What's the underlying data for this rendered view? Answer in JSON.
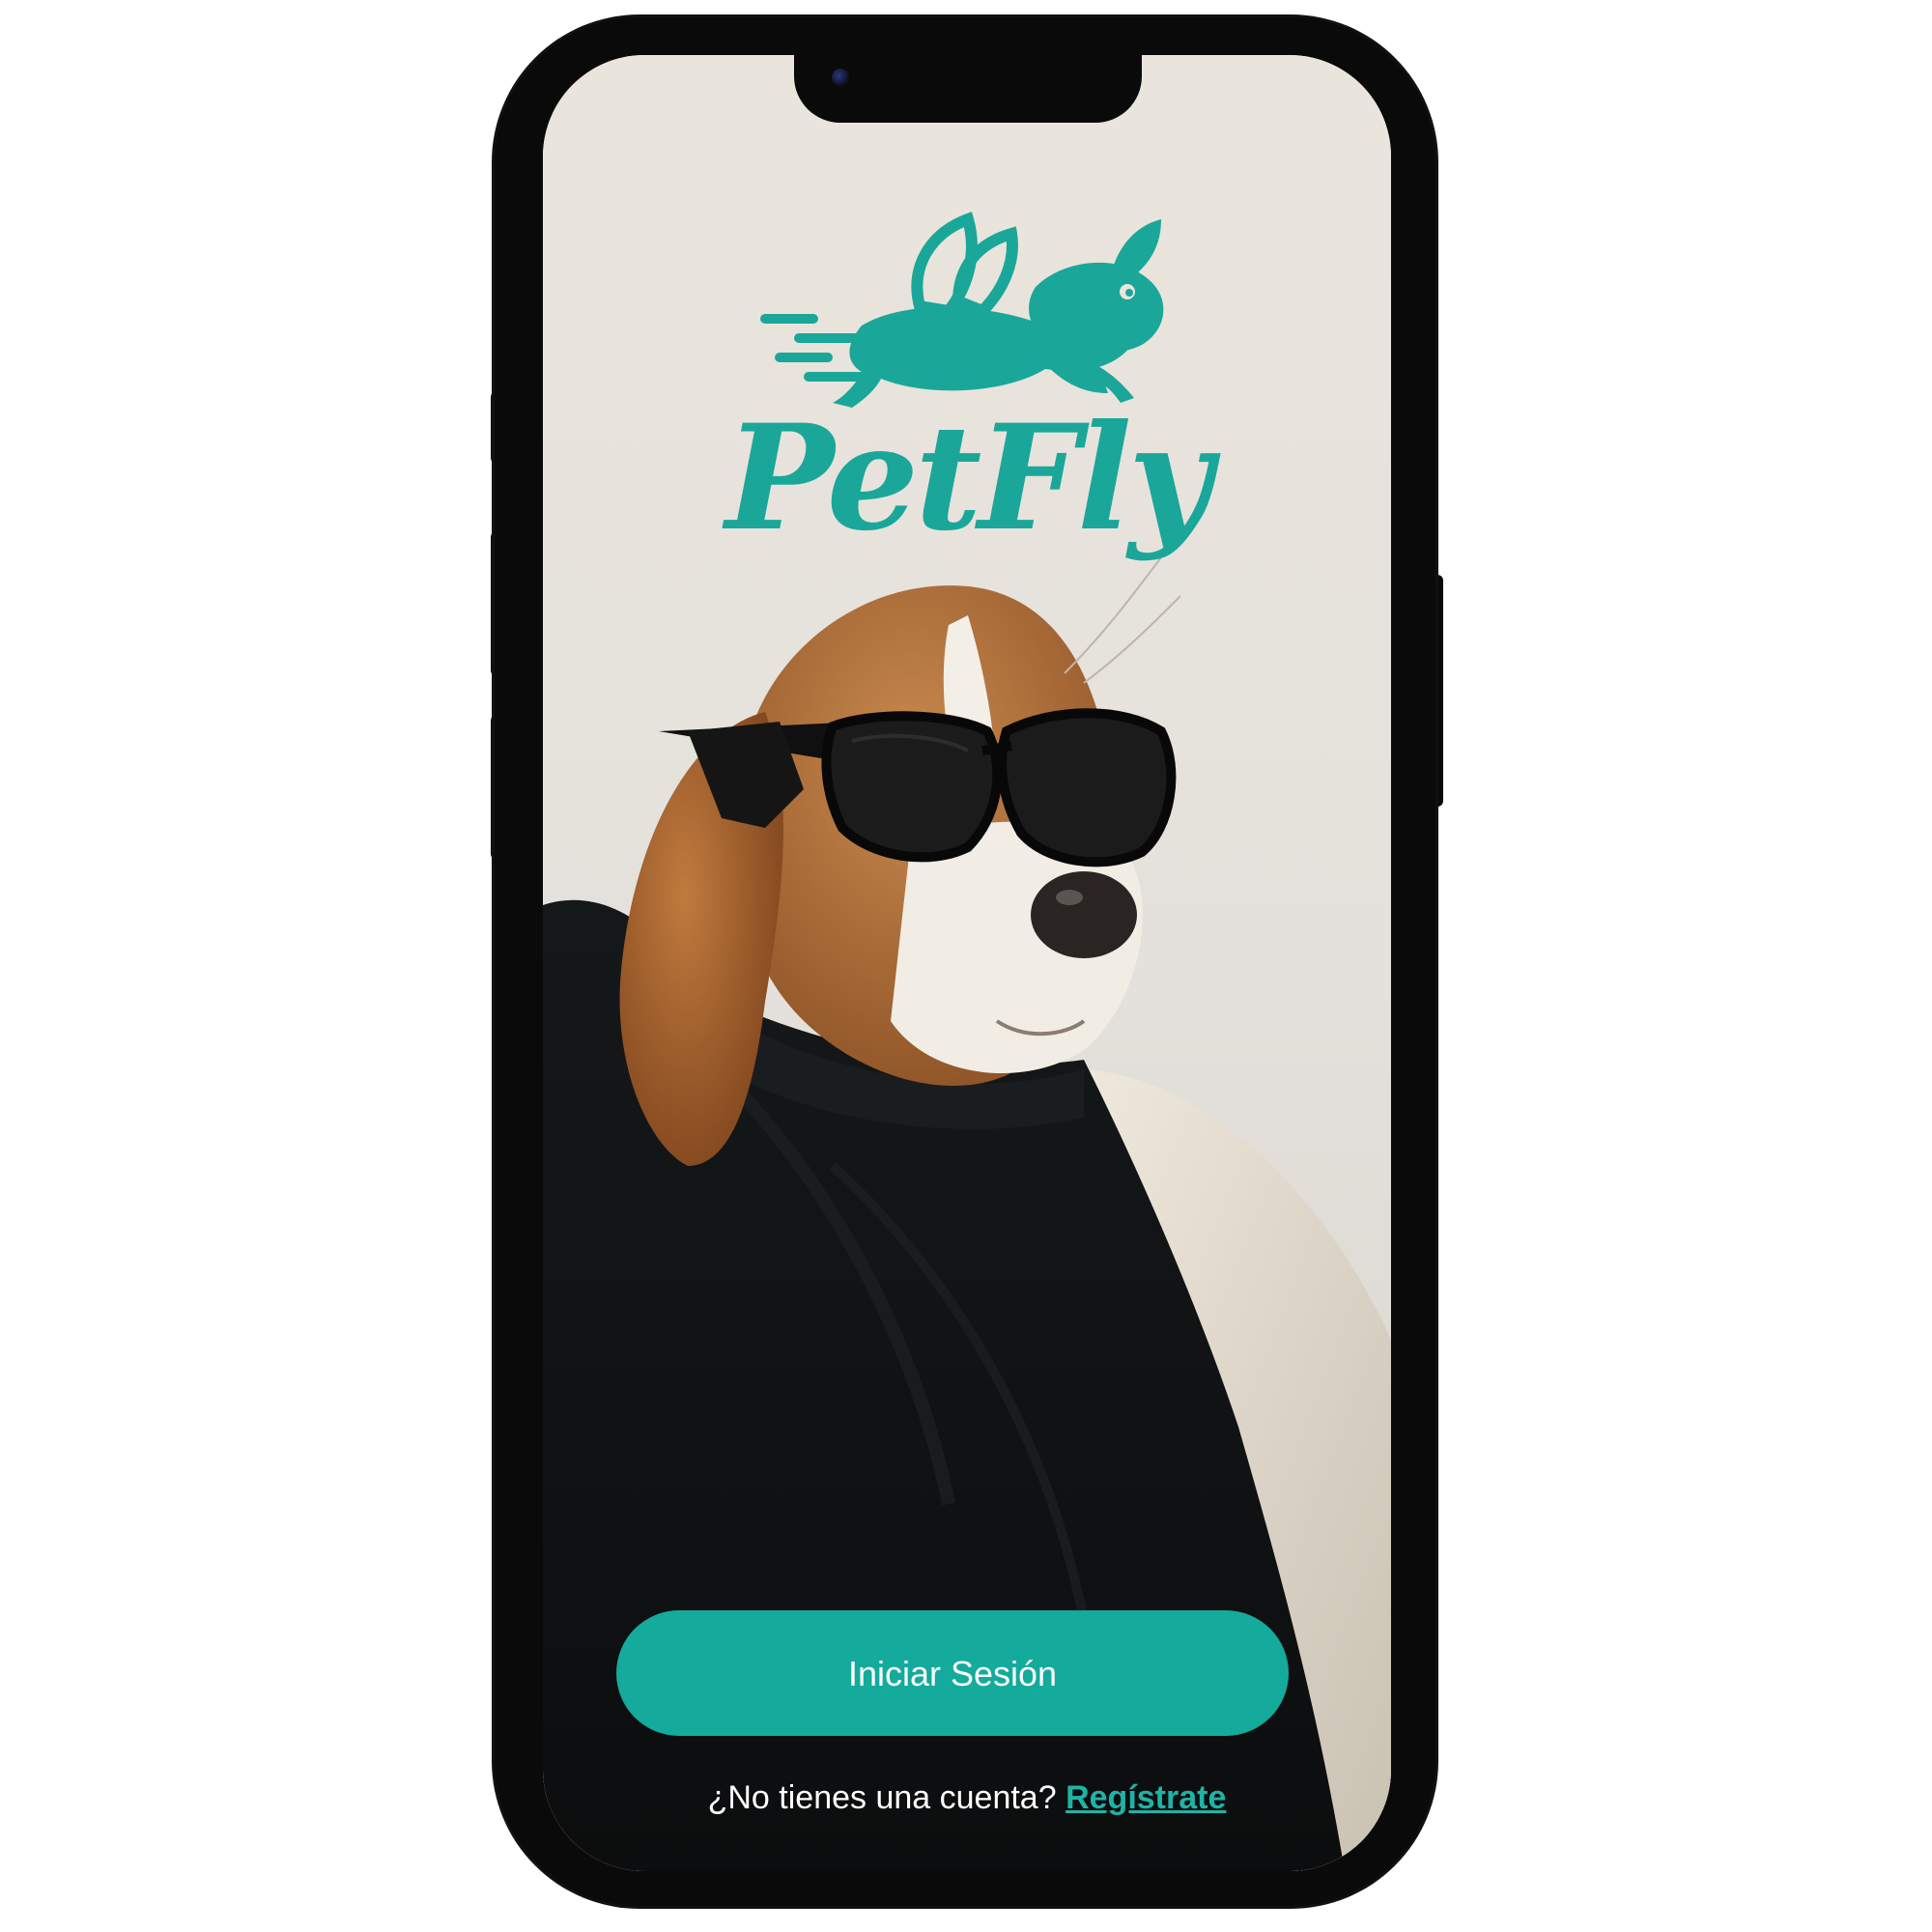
{
  "app": {
    "name": "PetFly"
  },
  "brand": {
    "wordmark": "PetFly",
    "accent_color": "#14aa9c",
    "logo_icon": "flying-dog-icon"
  },
  "hero": {
    "image_description_icon": "beagle-sunglasses-photo"
  },
  "actions": {
    "login_label": "Iniciar Sesión",
    "signup_prompt": "¿No tienes una cuenta?",
    "signup_link": "Regístrate"
  }
}
